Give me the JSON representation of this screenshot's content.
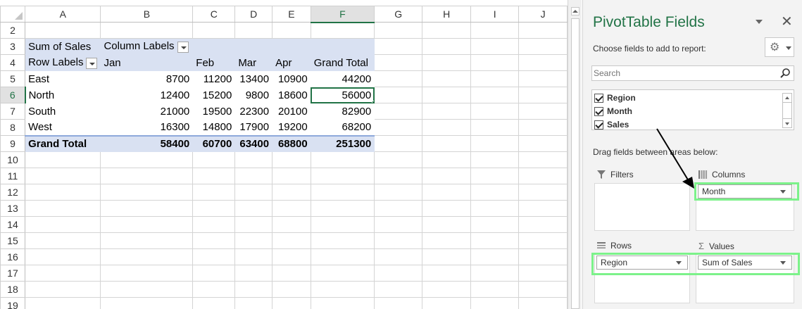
{
  "sheet": {
    "columns": [
      "A",
      "B",
      "C",
      "D",
      "E",
      "F",
      "G",
      "H",
      "I",
      "J"
    ],
    "rows": [
      {
        "n": "2",
        "cells": [
          "",
          "",
          "",
          "",
          "",
          ""
        ]
      },
      {
        "n": "3",
        "cells": [
          "Sum of Sales",
          "Column Labels",
          "",
          "",
          "",
          ""
        ]
      },
      {
        "n": "4",
        "cells": [
          "Row Labels",
          "Jan",
          "Feb",
          "Mar",
          "Apr",
          "Grand Total"
        ]
      },
      {
        "n": "5",
        "cells": [
          "East",
          "8700",
          "11200",
          "13400",
          "10900",
          "44200"
        ]
      },
      {
        "n": "6",
        "cells": [
          "North",
          "12400",
          "15200",
          "9800",
          "18600",
          "56000"
        ]
      },
      {
        "n": "7",
        "cells": [
          "South",
          "21000",
          "19500",
          "22300",
          "20100",
          "82900"
        ]
      },
      {
        "n": "8",
        "cells": [
          "West",
          "16300",
          "14800",
          "17900",
          "19200",
          "68200"
        ]
      },
      {
        "n": "9",
        "cells": [
          "Grand Total",
          "58400",
          "60700",
          "63400",
          "68800",
          "251300"
        ]
      },
      {
        "n": "10",
        "cells": [
          "",
          "",
          "",
          "",
          "",
          ""
        ]
      },
      {
        "n": "11",
        "cells": [
          "",
          "",
          "",
          "",
          "",
          ""
        ]
      },
      {
        "n": "12",
        "cells": [
          "",
          "",
          "",
          "",
          "",
          ""
        ]
      },
      {
        "n": "13",
        "cells": [
          "",
          "",
          "",
          "",
          "",
          ""
        ]
      },
      {
        "n": "14",
        "cells": [
          "",
          "",
          "",
          "",
          "",
          ""
        ]
      },
      {
        "n": "15",
        "cells": [
          "",
          "",
          "",
          "",
          "",
          ""
        ]
      },
      {
        "n": "16",
        "cells": [
          "",
          "",
          "",
          "",
          "",
          ""
        ]
      },
      {
        "n": "17",
        "cells": [
          "",
          "",
          "",
          "",
          "",
          ""
        ]
      },
      {
        "n": "18",
        "cells": [
          "",
          "",
          "",
          "",
          "",
          ""
        ]
      },
      {
        "n": "19",
        "cells": [
          "",
          "",
          "",
          "",
          "",
          ""
        ]
      }
    ],
    "active_cell": "F6",
    "colors": {
      "pivot_header": "#d9e1f2",
      "accent": "#217346",
      "highlight": "#7cf28a"
    }
  },
  "pane": {
    "title": "PivotTable Fields",
    "choose_label": "Choose fields to add to report:",
    "search_placeholder": "Search",
    "fields": [
      {
        "label": "Region",
        "checked": true
      },
      {
        "label": "Month",
        "checked": true
      },
      {
        "label": "Sales",
        "checked": true
      }
    ],
    "drag_label": "Drag fields between areas below:",
    "areas": {
      "filters": {
        "label": "Filters",
        "items": []
      },
      "columns": {
        "label": "Columns",
        "items": [
          "Month"
        ]
      },
      "rows": {
        "label": "Rows",
        "items": [
          "Region"
        ]
      },
      "values": {
        "label": "Values",
        "items": [
          "Sum of Sales"
        ]
      }
    },
    "icons": {
      "close": "close-icon",
      "gear": "gear-icon",
      "search": "search-icon"
    }
  }
}
